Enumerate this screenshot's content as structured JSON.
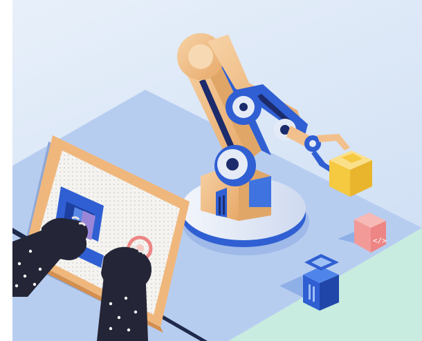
{
  "illustration": {
    "subject": "",
    "icons": {
      "robot_arm": "robot-arm-icon",
      "tablet": "tablet-icon",
      "yellow_cube": "cube-icon",
      "code_cube": "code-cube-icon",
      "box": "stacked-box-icon",
      "hands": "hands-icon"
    },
    "code_glyph": "</>",
    "colors": {
      "background": "#dce8f6",
      "table": "#b7cdf0",
      "table_shadow": "#9fb9e8",
      "mint": "#c8ecdf",
      "robot_orange": "#f2c08c",
      "robot_blue": "#2f5fd2",
      "robot_dark": "#1c2b6b",
      "base": "#e4ebf6",
      "tablet_frame": "#f0b77c",
      "tablet_screen": "#f4f3f0",
      "yellow": "#f5c940",
      "pink": "#f29a98",
      "navy": "#242536"
    }
  }
}
